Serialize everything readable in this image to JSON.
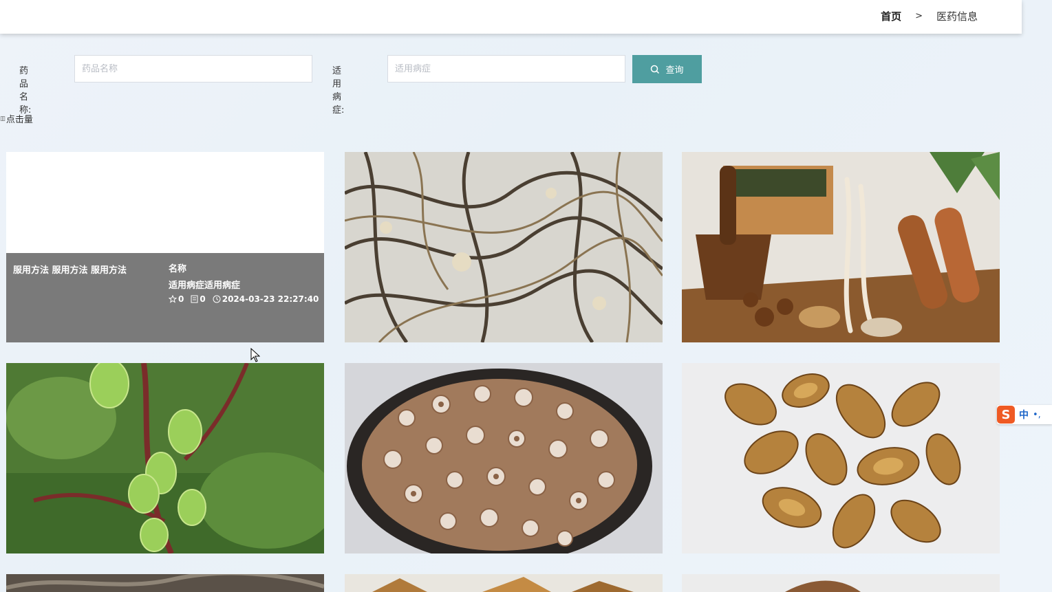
{
  "header": {
    "breadcrumb_home": "首页",
    "breadcrumb_sep": ">",
    "breadcrumb_current": "医药信息"
  },
  "search": {
    "name_label": "药品名称:",
    "name_placeholder": "药品名称",
    "disease_label": "适用病症:",
    "disease_placeholder": "适用病症",
    "query_button": "查询"
  },
  "sort": {
    "label": "点击量"
  },
  "cards": [
    {
      "usage": "服用方法 服用方法 服用方法",
      "name": "名称",
      "disease": "适用病症适用病症",
      "likes": "0",
      "comments": "0",
      "time": "2024-03-23 22:27:40"
    }
  ],
  "ime": {
    "zh": "中",
    "punct": "•,"
  },
  "colors": {
    "accent": "#4f9ea0",
    "overlay": "#7a7a7a"
  },
  "icons": [
    "search-icon",
    "star-icon",
    "comment-icon",
    "clock-icon",
    "sort-icon"
  ]
}
